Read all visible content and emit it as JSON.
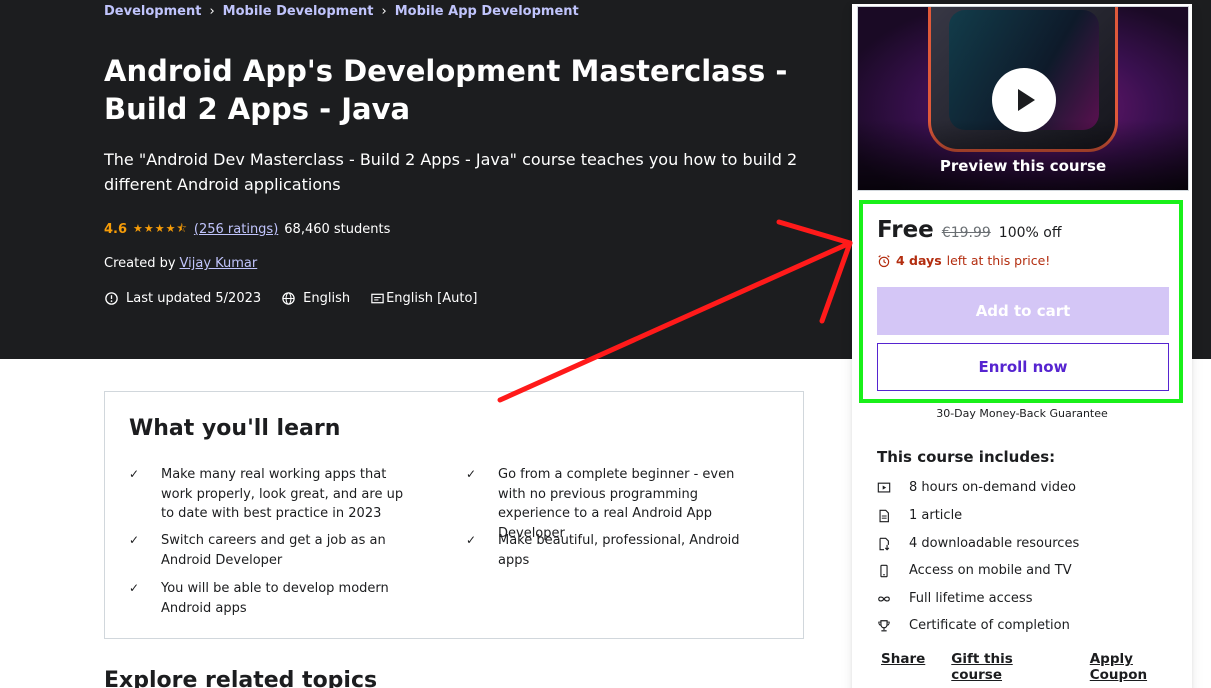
{
  "breadcrumb": [
    "Development",
    "Mobile Development",
    "Mobile App Development"
  ],
  "course": {
    "title": "Android App's Development Masterclass - Build 2 Apps - Java",
    "subtitle": "The \"Android Dev Masterclass - Build 2 Apps - Java\" course teaches you how to build 2 different Android applications",
    "rating": "4.6",
    "stars": "★★★★⯪",
    "ratings_count": "(256 ratings)",
    "students": "68,460 students",
    "created_by_label": "Created by",
    "author": "Vijay Kumar",
    "last_updated": "Last updated 5/2023",
    "language": "English",
    "captions": "English [Auto]"
  },
  "learn": {
    "heading": "What you'll learn",
    "check_icon": "✓",
    "items": [
      "Make many real working apps that work properly, look great, and are up to date with best practice in 2023",
      "Go from a complete beginner - even with no previous programming experience to a real Android App Developer",
      "Switch careers and get a job as an Android Developer",
      "Make beautiful, professional, Android apps",
      "You will be able to develop modern Android apps"
    ]
  },
  "explore_heading": "Explore related topics",
  "sidebar": {
    "preview_label": "Preview this course",
    "price": "Free",
    "original_price": "€19.99",
    "discount": "100% off",
    "timer_bold": "4 days",
    "timer_rest": "left at this price!",
    "add_to_cart": "Add to cart",
    "enroll_now": "Enroll now",
    "guarantee": "30-Day Money-Back Guarantee",
    "includes_title": "This course includes:",
    "includes": [
      {
        "icon": "video-icon",
        "text": "8 hours on-demand video"
      },
      {
        "icon": "article-icon",
        "text": "1 article"
      },
      {
        "icon": "download-icon",
        "text": "4 downloadable resources"
      },
      {
        "icon": "mobile-icon",
        "text": "Access on mobile and TV"
      },
      {
        "icon": "infinity-icon",
        "text": "Full lifetime access"
      },
      {
        "icon": "trophy-icon",
        "text": "Certificate of completion"
      }
    ],
    "links": [
      "Share",
      "Gift this course",
      "Apply Coupon"
    ]
  },
  "colors": {
    "hero_bg": "#1c1d1f",
    "link_purple": "#c0c4fc",
    "star_orange": "#f69c08",
    "brand_purple": "#5624d0",
    "highlight_green": "#19f019",
    "arrow_red": "#ff1a1a"
  }
}
